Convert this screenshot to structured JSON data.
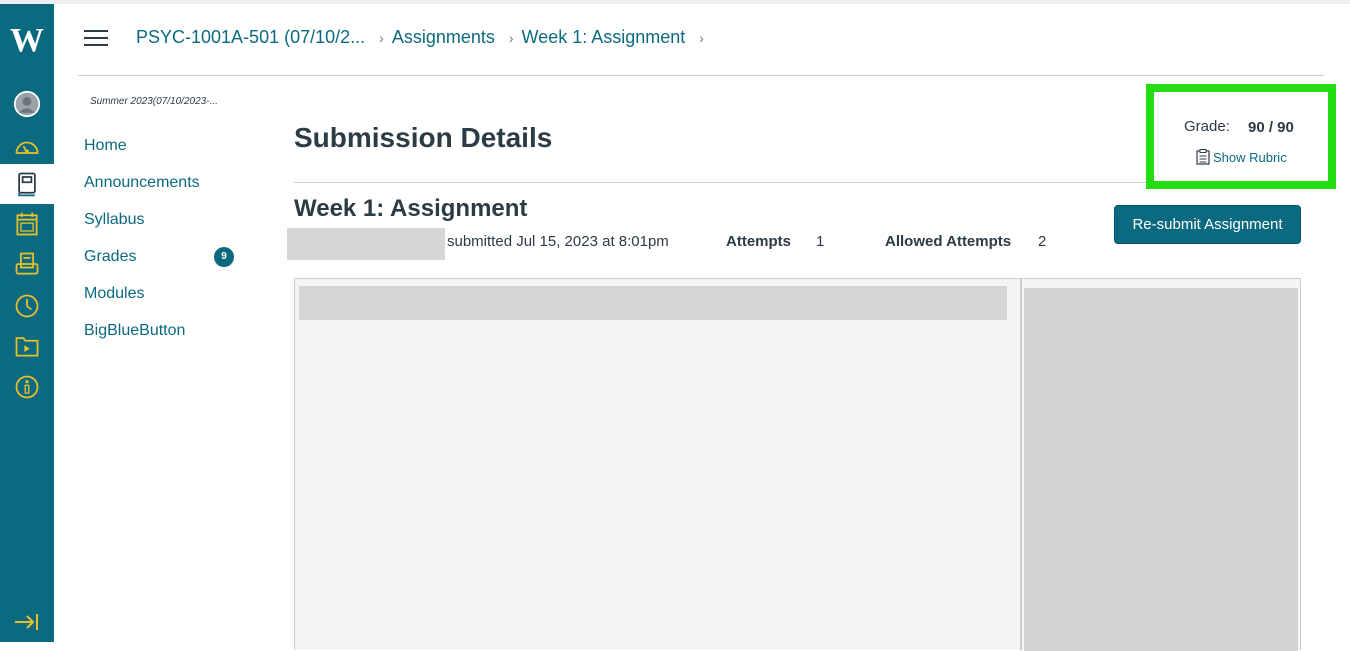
{
  "global_nav": {
    "logo": "W",
    "items": [
      {
        "name": "account",
        "icon": "avatar-icon"
      },
      {
        "name": "dashboard",
        "icon": "dashboard-icon"
      },
      {
        "name": "courses",
        "icon": "book-icon",
        "active": true
      },
      {
        "name": "calendar",
        "icon": "calendar-icon"
      },
      {
        "name": "inbox",
        "icon": "inbox-icon"
      },
      {
        "name": "history",
        "icon": "clock-icon"
      },
      {
        "name": "studio",
        "icon": "folder-play-icon"
      },
      {
        "name": "help",
        "icon": "info-icon"
      }
    ],
    "collapse_icon": "collapse-arrow-icon",
    "colors": {
      "background": "#0b6a80",
      "icon": "#e8c12a"
    }
  },
  "header": {
    "breadcrumb": [
      {
        "label": "PSYC-1001A-501 (07/10/2..."
      },
      {
        "label": "Assignments"
      },
      {
        "label": "Week 1: Assignment"
      }
    ]
  },
  "course_nav": {
    "term": "Summer 2023(07/10/2023-...",
    "items": [
      {
        "label": "Home"
      },
      {
        "label": "Announcements"
      },
      {
        "label": "Syllabus"
      },
      {
        "label": "Grades",
        "badge": "9"
      },
      {
        "label": "Modules"
      },
      {
        "label": "BigBlueButton"
      }
    ]
  },
  "main": {
    "page_title": "Submission Details",
    "assignment_title": "Week 1: Assignment",
    "submitted_text": "submitted Jul 15, 2023 at 8:01pm",
    "attempts_label": "Attempts",
    "attempts_value": "1",
    "allowed_attempts_label": "Allowed Attempts",
    "allowed_attempts_value": "2",
    "resubmit_label": "Re-submit Assignment"
  },
  "grade": {
    "label": "Grade:",
    "value": "90 / 90",
    "rubric_label": "Show Rubric",
    "highlight_color": "#22dd11"
  }
}
